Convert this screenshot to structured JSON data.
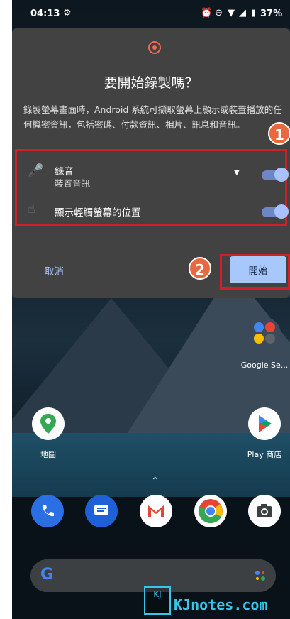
{
  "status_bar": {
    "time": "04:13",
    "battery": "37%",
    "icons": [
      "incognito-icon",
      "alarm-icon",
      "dnd-icon",
      "wifi-icon",
      "signal-icon",
      "battery-icon"
    ]
  },
  "dialog": {
    "title": "要開始錄製嗎？",
    "description": "錄製螢幕畫面時，Android 系統可擷取螢幕上顯示或裝置播放的任何機密資訊，包括密碼、付款資訊、相片、訊息和音訊。",
    "options": [
      {
        "label": "錄音",
        "sublabel": "裝置音訊",
        "icon": "microphone-icon",
        "toggled": true,
        "has_dropdown": true
      },
      {
        "label": "顯示輕觸螢幕的位置",
        "sublabel": "",
        "icon": "touch-icon",
        "toggled": true,
        "has_dropdown": false
      }
    ],
    "cancel_label": "取消",
    "start_label": "開始",
    "accent_color": "#a8c7fa",
    "record_color": "#f16b4f"
  },
  "callouts": {
    "first": "1",
    "second": "2"
  },
  "home": {
    "apps_top": [
      {
        "label": "地圖",
        "icon": "maps-icon"
      },
      {
        "label": "Play 商店",
        "icon": "play-store-icon"
      }
    ],
    "folder_label": "Google Se...",
    "dock": [
      "phone-icon",
      "messages-icon",
      "gmail-icon",
      "chrome-icon",
      "camera-icon"
    ],
    "search_logo": "G"
  },
  "watermark": {
    "logo": "KJ",
    "text": "KJnotes.com"
  }
}
